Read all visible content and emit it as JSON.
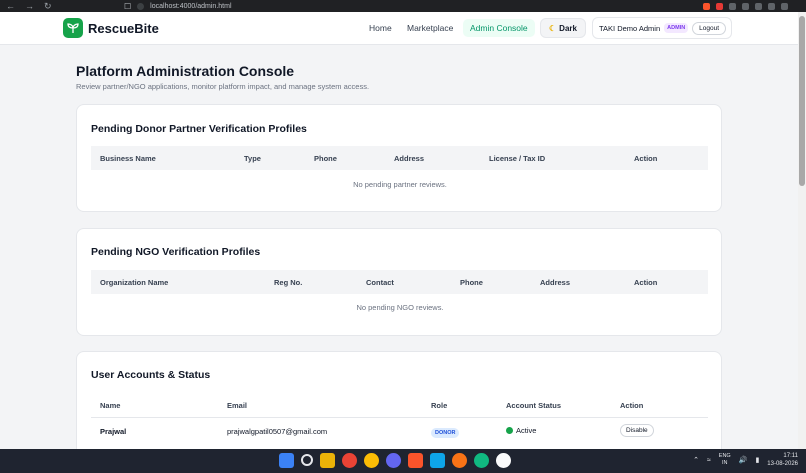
{
  "browser": {
    "url": "localhost:4000/admin.html"
  },
  "header": {
    "brand": "RescueBite",
    "nav": [
      "Home",
      "Marketplace",
      "Admin Console"
    ],
    "dark_label": "Dark",
    "user_name": "TAKI Demo Admin",
    "role_badge": "ADMIN",
    "logout_label": "Logout"
  },
  "page": {
    "title": "Platform Administration Console",
    "subtitle": "Review partner/NGO applications, monitor platform impact, and manage system access."
  },
  "donor_section": {
    "title": "Pending Donor Partner Verification Profiles",
    "columns": [
      "Business Name",
      "Type",
      "Phone",
      "Address",
      "License / Tax ID",
      "Action"
    ],
    "empty": "No pending partner reviews."
  },
  "ngo_section": {
    "title": "Pending NGO Verification Profiles",
    "columns": [
      "Organization Name",
      "Reg No.",
      "Contact",
      "Phone",
      "Address",
      "Action"
    ],
    "empty": "No pending NGO reviews."
  },
  "users_section": {
    "title": "User Accounts & Status",
    "columns": [
      "Name",
      "Email",
      "Role",
      "Account Status",
      "Action"
    ],
    "rows": [
      {
        "name": "Prajwal",
        "email": "prajwalgpatil0507@gmail.com",
        "role": "DONOR",
        "status": "Active",
        "action": "Disable"
      }
    ]
  },
  "taskbar": {
    "lang_top": "ENG",
    "lang_bottom": "IN",
    "time": "17:11",
    "date": "13-08-2026"
  },
  "colors": {
    "brand_green": "#16a34a",
    "accent_green": "#059669",
    "role_purple": "#7c3aed",
    "donor_blue": "#1d4ed8"
  }
}
